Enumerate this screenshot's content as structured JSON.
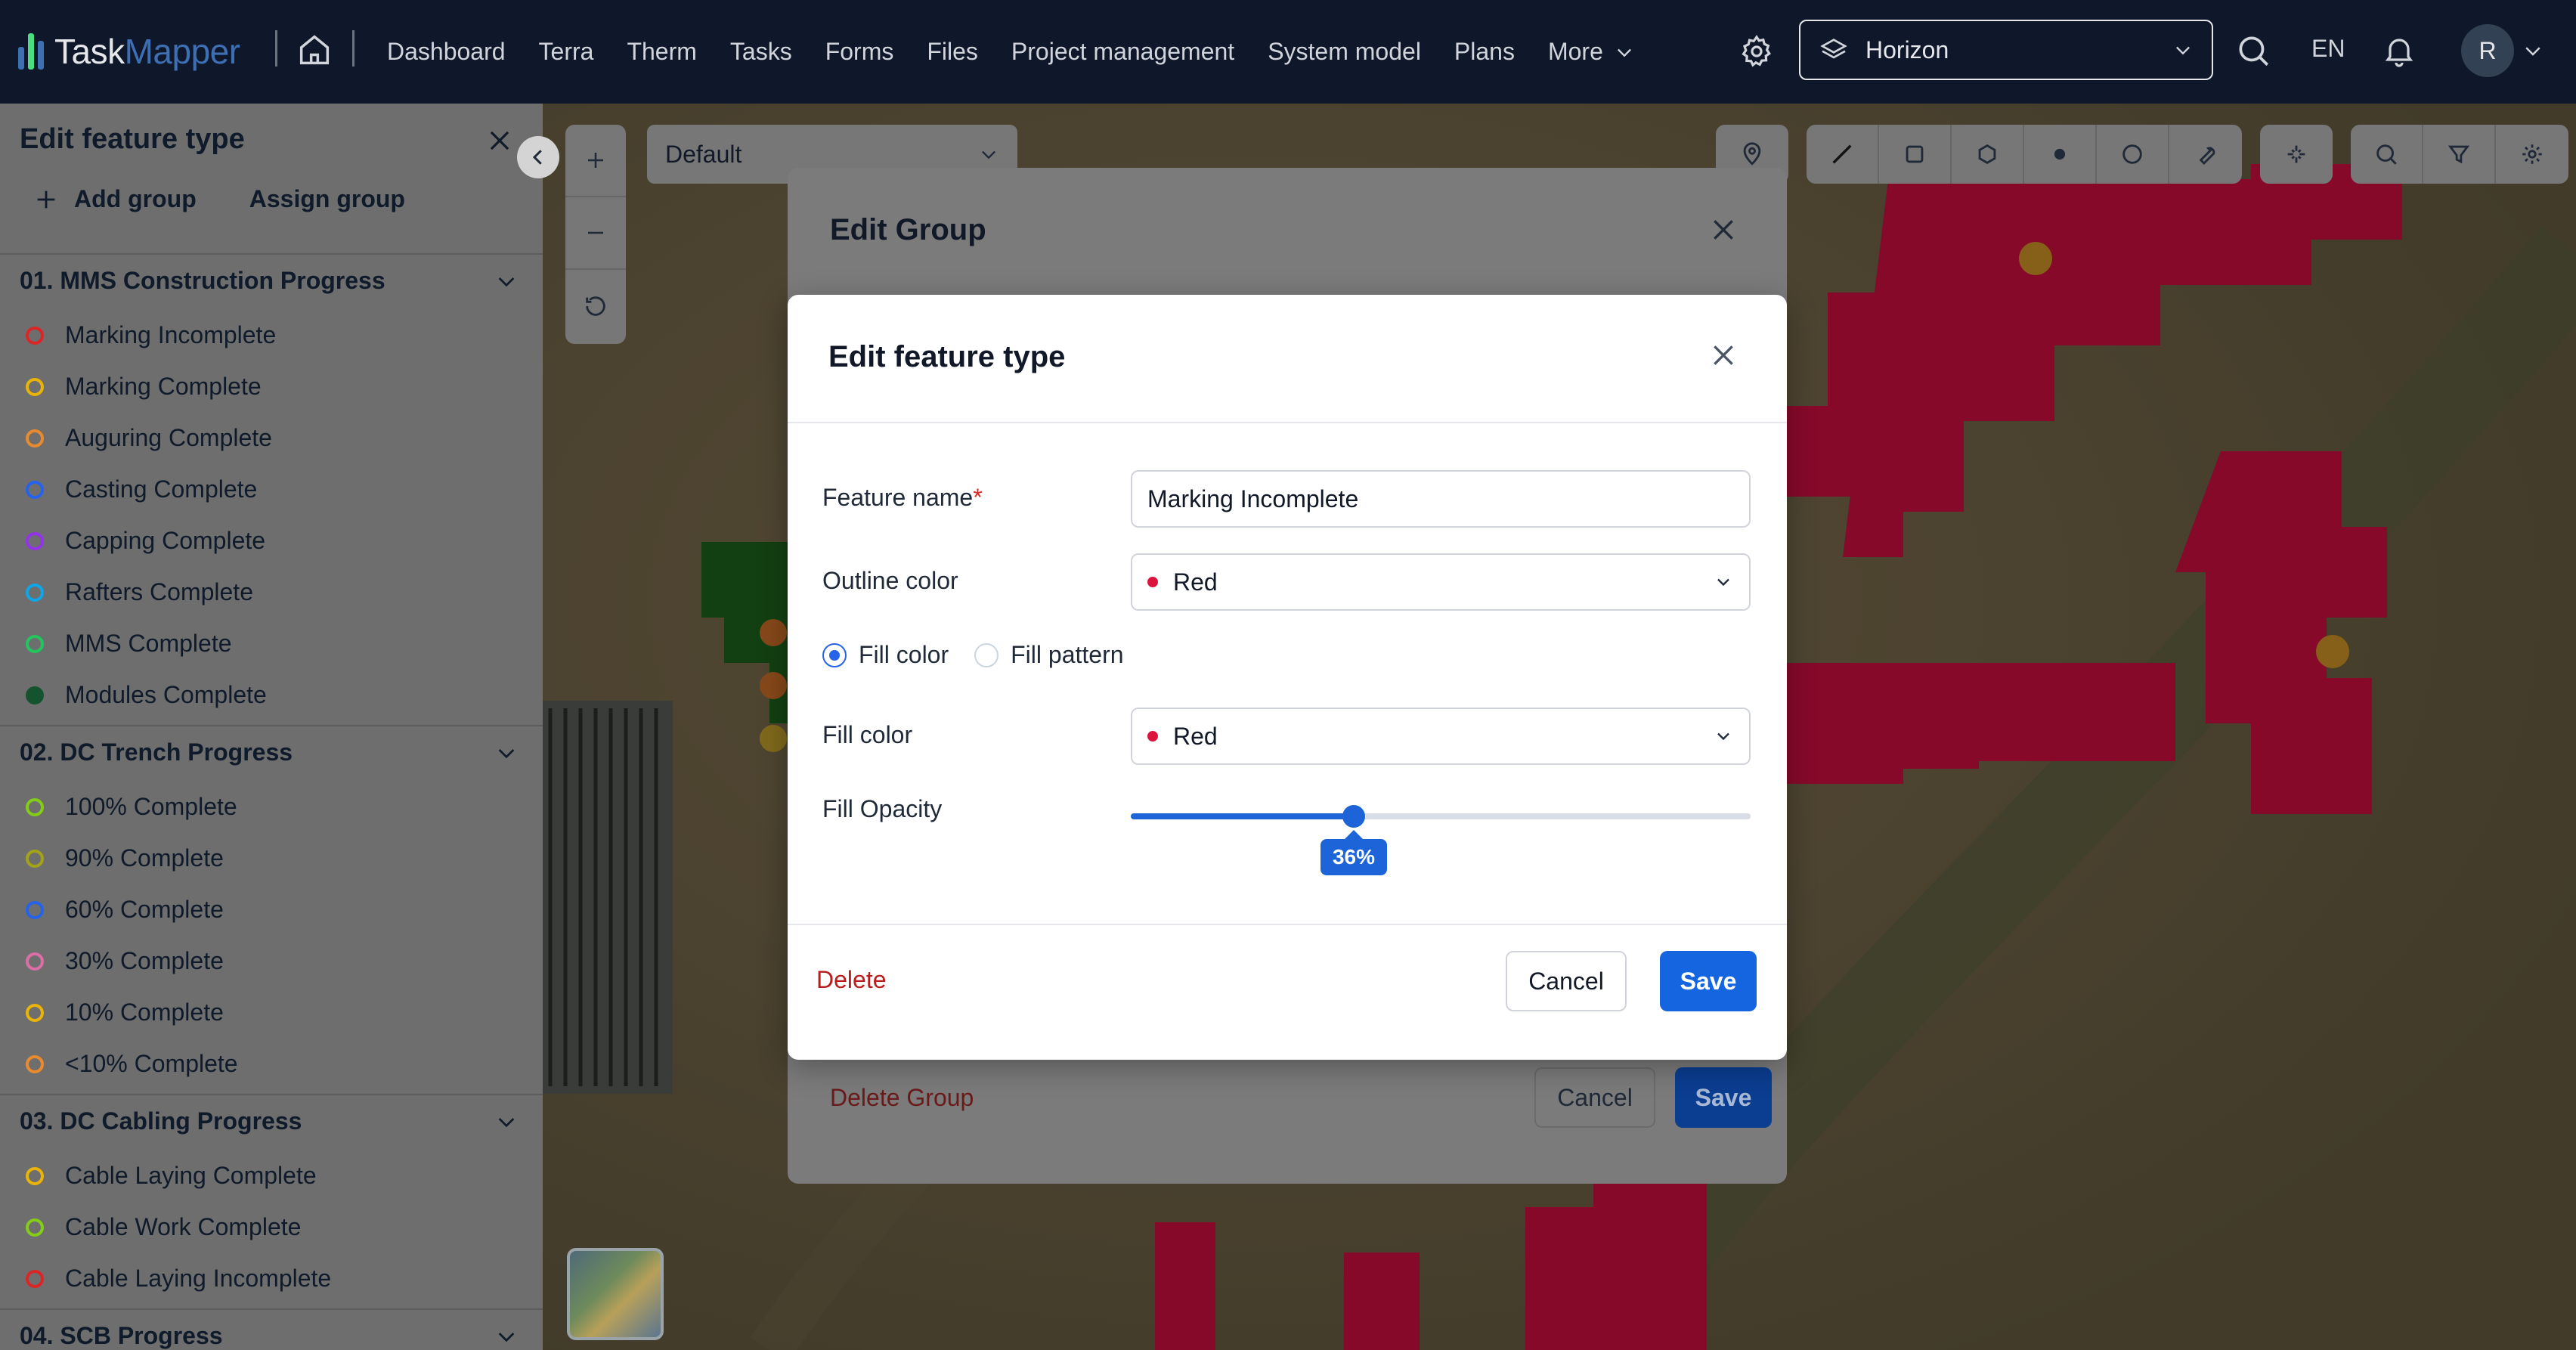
{
  "app": {
    "logo_part1": "Task",
    "logo_part2": "Mapper"
  },
  "nav": {
    "items": [
      "Dashboard",
      "Terra",
      "Therm",
      "Tasks",
      "Forms",
      "Files",
      "Project management",
      "System model",
      "Plans"
    ],
    "more_label": "More"
  },
  "header": {
    "project": "Horizon",
    "language": "EN",
    "avatar_initial": "R"
  },
  "left_panel": {
    "title": "Edit feature type",
    "add_group": "Add group",
    "assign_group": "Assign group",
    "groups": [
      {
        "name": "01. MMS Construction Progress",
        "items": [
          {
            "label": "Marking Incomplete",
            "color": "#dc2626"
          },
          {
            "label": "Marking Complete",
            "color": "#eab308"
          },
          {
            "label": "Auguring Complete",
            "color": "#ea8a2e"
          },
          {
            "label": "Casting Complete",
            "color": "#2563eb"
          },
          {
            "label": "Capping Complete",
            "color": "#9333ea"
          },
          {
            "label": "Rafters Complete",
            "color": "#0ea5e9"
          },
          {
            "label": "MMS Complete",
            "color": "#22c55e"
          },
          {
            "label": "Modules Complete",
            "color": "#14532d"
          }
        ]
      },
      {
        "name": "02. DC Trench Progress",
        "items": [
          {
            "label": "100% Complete",
            "color": "#84cc16"
          },
          {
            "label": "90% Complete",
            "color": "#a3a31a"
          },
          {
            "label": "60% Complete",
            "color": "#2563eb"
          },
          {
            "label": "30% Complete",
            "color": "#db6ea5"
          },
          {
            "label": "10% Complete",
            "color": "#eab308"
          },
          {
            "label": "<10% Complete",
            "color": "#ea8a2e"
          }
        ]
      },
      {
        "name": "03. DC Cabling Progress",
        "items": [
          {
            "label": "Cable Laying Complete",
            "color": "#eab308"
          },
          {
            "label": "Cable Work Complete",
            "color": "#84cc16"
          },
          {
            "label": "Cable Laying Incomplete",
            "color": "#dc2626"
          }
        ]
      },
      {
        "name": "04. SCB Progress",
        "items": []
      }
    ]
  },
  "map": {
    "style_select": "Default"
  },
  "edit_group": {
    "title": "Edit Group",
    "delete_label": "Delete Group",
    "cancel_label": "Cancel",
    "save_label": "Save"
  },
  "edit_feature": {
    "title": "Edit feature type",
    "feature_name_label": "Feature name",
    "required_mark": "*",
    "feature_name_value": "Marking Incomplete",
    "outline_color_label": "Outline color",
    "outline_color_value": "Red",
    "fill_mode_options": [
      "Fill color",
      "Fill pattern"
    ],
    "fill_mode_selected": "Fill color",
    "fill_color_label": "Fill color",
    "fill_color_value": "Red",
    "fill_opacity_label": "Fill Opacity",
    "fill_opacity_percent": 36,
    "fill_opacity_text": "36%",
    "swatch_color": "#dc143c",
    "delete_label": "Delete",
    "cancel_label": "Cancel",
    "save_label": "Save"
  }
}
